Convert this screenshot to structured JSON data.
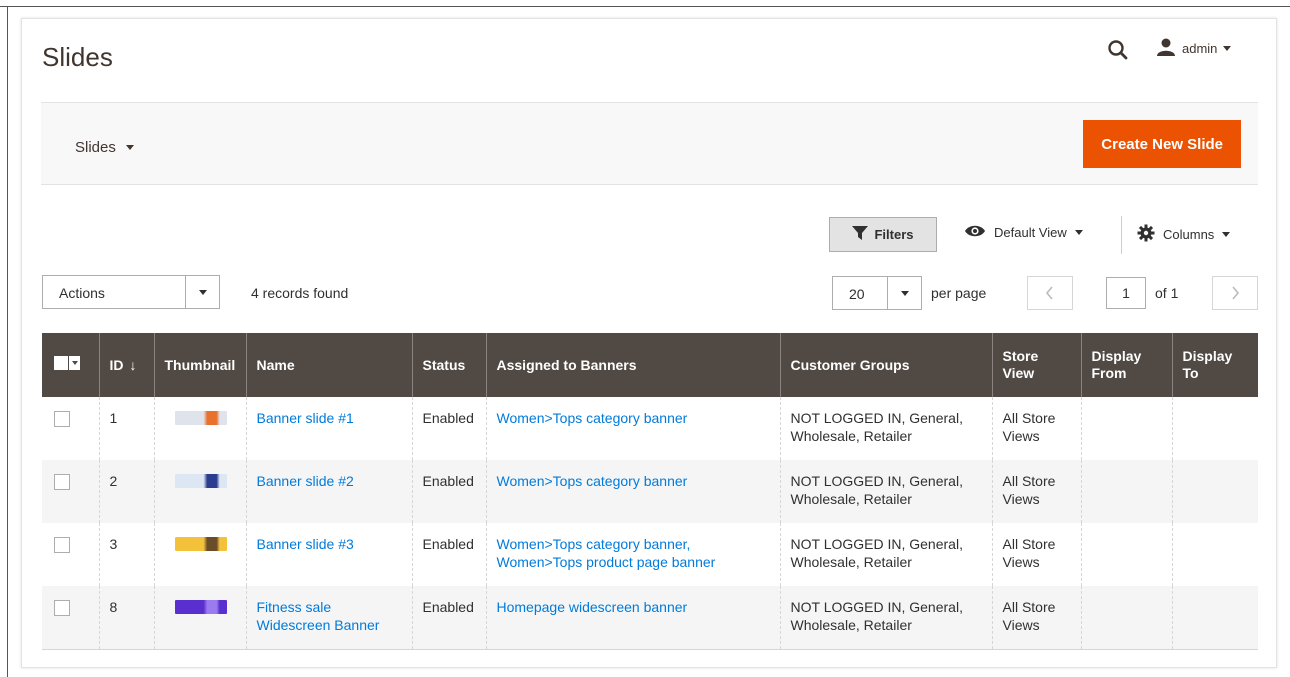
{
  "header": {
    "title": "Slides",
    "user_label": "admin",
    "search_icon": "search-icon",
    "user_icon": "user-icon"
  },
  "toolbar": {
    "switcher_label": "Slides",
    "create_label": "Create New Slide",
    "filters_label": "Filters",
    "view_label": "Default View",
    "columns_label": "Columns"
  },
  "controls": {
    "actions_label": "Actions",
    "records_text": "4 records found",
    "per_page_value": "20",
    "per_page_label": "per page",
    "page_value": "1",
    "page_of": "of 1"
  },
  "colors": {
    "accent": "#eb5202",
    "header_bg": "#514943",
    "link": "#007bdb"
  },
  "table": {
    "columns": [
      "ID",
      "Thumbnail",
      "Name",
      "Status",
      "Assigned to Banners",
      "Customer Groups",
      "Store View",
      "Display From",
      "Display To"
    ],
    "sort_indicator": "↓",
    "rows": [
      {
        "id": "1",
        "name": "Banner slide #1",
        "status": "Enabled",
        "banners": "Women>Tops category banner",
        "groups": "NOT LOGGED IN, General, Wholesale, Retailer",
        "store": "All Store Views",
        "from": "",
        "to": "",
        "thumb_color": "#dfe3ec",
        "thumb_accent": "#e8712e"
      },
      {
        "id": "2",
        "name": "Banner slide #2",
        "status": "Enabled",
        "banners": "Women>Tops category banner",
        "groups": "NOT LOGGED IN, General, Wholesale, Retailer",
        "store": "All Store Views",
        "from": "",
        "to": "",
        "thumb_color": "#dde6f3",
        "thumb_accent": "#2a3d8f"
      },
      {
        "id": "3",
        "name": "Banner slide #3",
        "status": "Enabled",
        "banners": "Women>Tops category banner, Women>Tops product page banner",
        "groups": "NOT LOGGED IN, General, Wholesale, Retailer",
        "store": "All Store Views",
        "from": "",
        "to": "",
        "thumb_color": "#f4c23a",
        "thumb_accent": "#6a4b2a"
      },
      {
        "id": "8",
        "name": "Fitness sale Widescreen Banner",
        "status": "Enabled",
        "banners": "Homepage widescreen banner",
        "groups": "NOT LOGGED IN, General, Wholesale, Retailer",
        "store": "All Store Views",
        "from": "",
        "to": "",
        "thumb_color": "#5a2fd0",
        "thumb_accent": "#9a7cf0"
      }
    ]
  }
}
